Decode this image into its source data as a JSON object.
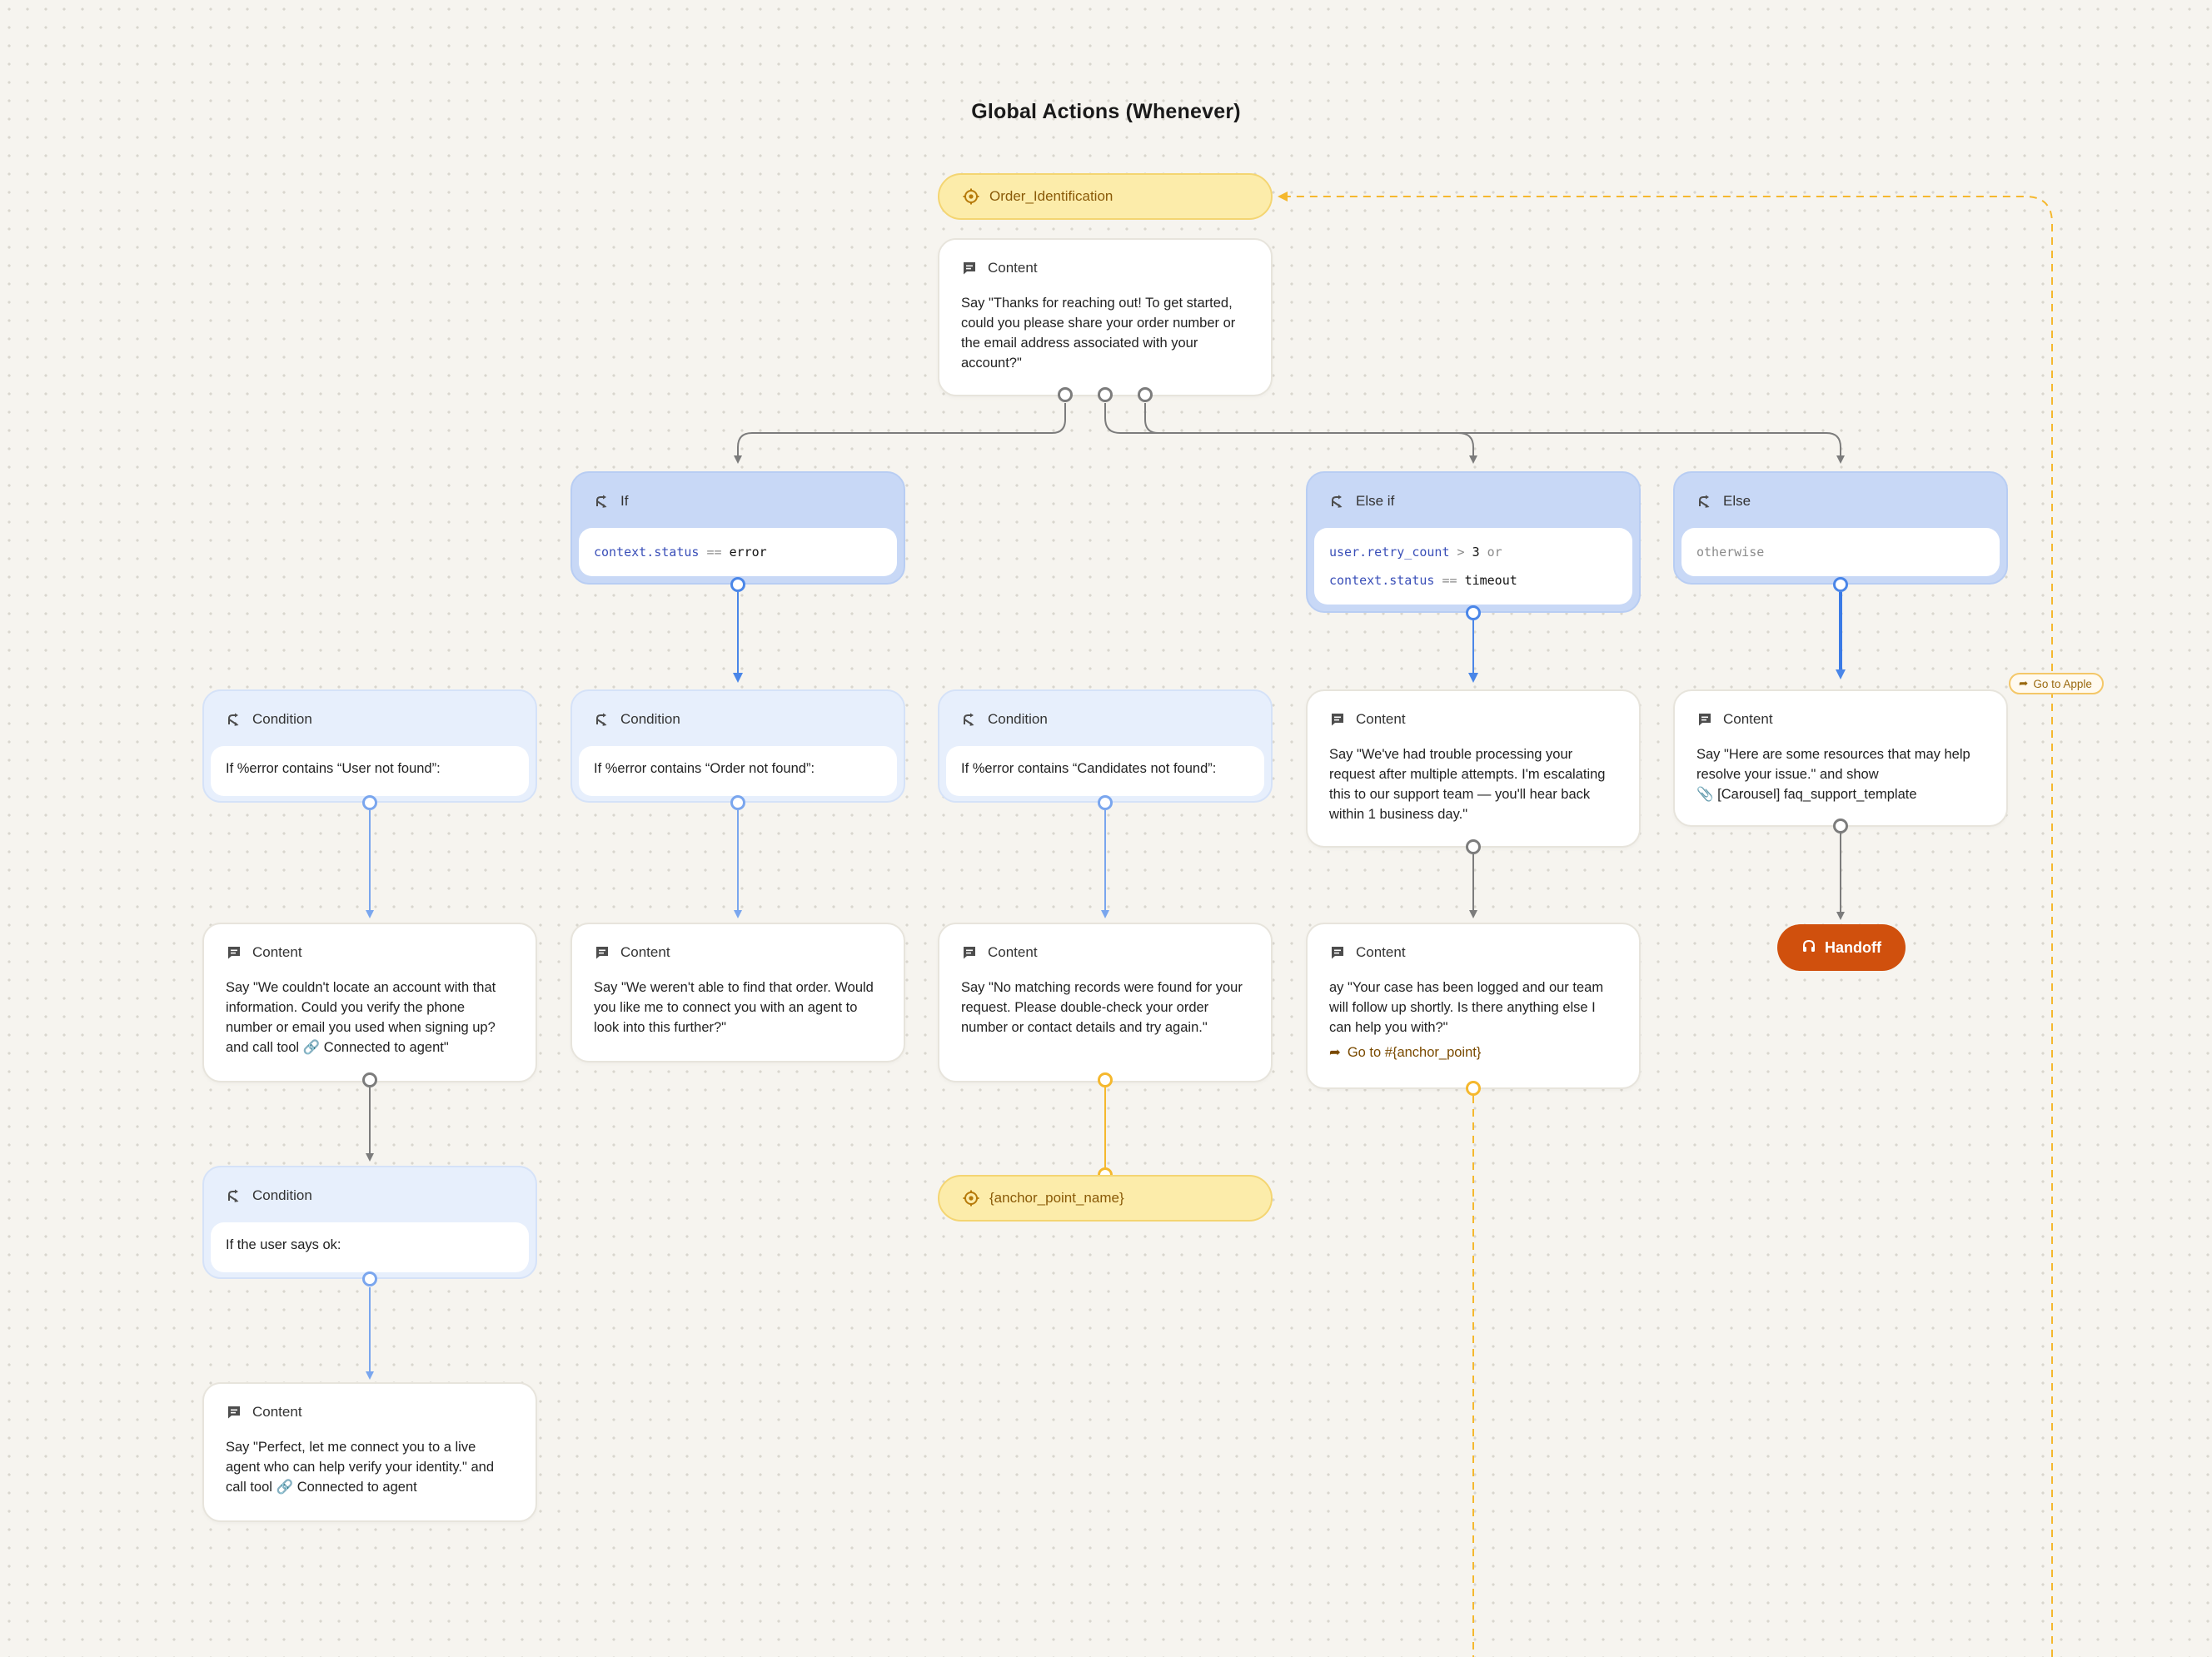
{
  "title": "Global Actions (Whenever)",
  "anchor_top": {
    "label": "Order_Identification"
  },
  "anchor_bottom": {
    "label": "{anchor_point_name}"
  },
  "content_top": {
    "header": "Content",
    "text": "Say \"Thanks for reaching out! To get started, could you please share your order number or the email address associated with your account?\""
  },
  "branch_if": {
    "header": "If",
    "expr": {
      "var": "context.status",
      "op": "==",
      "val": "error"
    }
  },
  "branch_elseif": {
    "header": "Else if",
    "expr1": {
      "var": "user.retry_count",
      "op": ">",
      "val": "3",
      "join": "or"
    },
    "expr2": {
      "var": "context.status",
      "op": "==",
      "val": "timeout"
    }
  },
  "branch_else": {
    "header": "Else",
    "expr": "otherwise"
  },
  "cond1": {
    "header": "Condition",
    "text": "If %error contains “User not found”:"
  },
  "cond2": {
    "header": "Condition",
    "text": "If %error contains “Order not found”:"
  },
  "cond3": {
    "header": "Condition",
    "text": "If %error contains “Candidates not found”:"
  },
  "cond4": {
    "header": "Condition",
    "text": "If the user says ok:"
  },
  "content_elseif_1": {
    "header": "Content",
    "text": "Say \"We've had trouble processing your request after multiple attempts. I'm escalating this to our support team — you'll hear back within 1 business day.\""
  },
  "content_else": {
    "header": "Content",
    "text_a": "Say \"Here are some resources that may help resolve your issue.\" and show",
    "text_b": "[Carousel] faq_support_template"
  },
  "content_c1": {
    "header": "Content",
    "text_a": "Say \"We couldn't locate an account with that information. Could you verify the phone number or email you used when signing up? and call tool",
    "text_b": "Connected to agent\""
  },
  "content_c2": {
    "header": "Content",
    "text": "Say \"We weren't able to find that order. Would you like me to connect you with an agent to look into this further?\""
  },
  "content_c3": {
    "header": "Content",
    "text": "Say \"No matching records were found for your request. Please double-check your order number or contact details and try again.\""
  },
  "content_elseif_2": {
    "header": "Content",
    "text": "ay \"Your case has been logged and our team will follow up shortly. Is there anything else I can help you with?\"",
    "goto": "Go to #{anchor_point}"
  },
  "content_c4": {
    "header": "Content",
    "text_a": "Say \"Perfect, let me connect you to a live agent who can help verify your identity.\" and call tool",
    "text_b": "Connected to agent"
  },
  "handoff": {
    "label": "Handoff"
  },
  "goto_tag": {
    "label": "Go to Apple"
  },
  "colors": {
    "background": "#f6f4ef",
    "condition": "#e7effc",
    "branch": "#c8d8f6",
    "anchor": "#fcecaa",
    "handoff": "#d0500d",
    "edge_gray": "#7c7c7c",
    "edge_blue": "#4a86e8",
    "edge_yellow": "#f5b82e"
  }
}
